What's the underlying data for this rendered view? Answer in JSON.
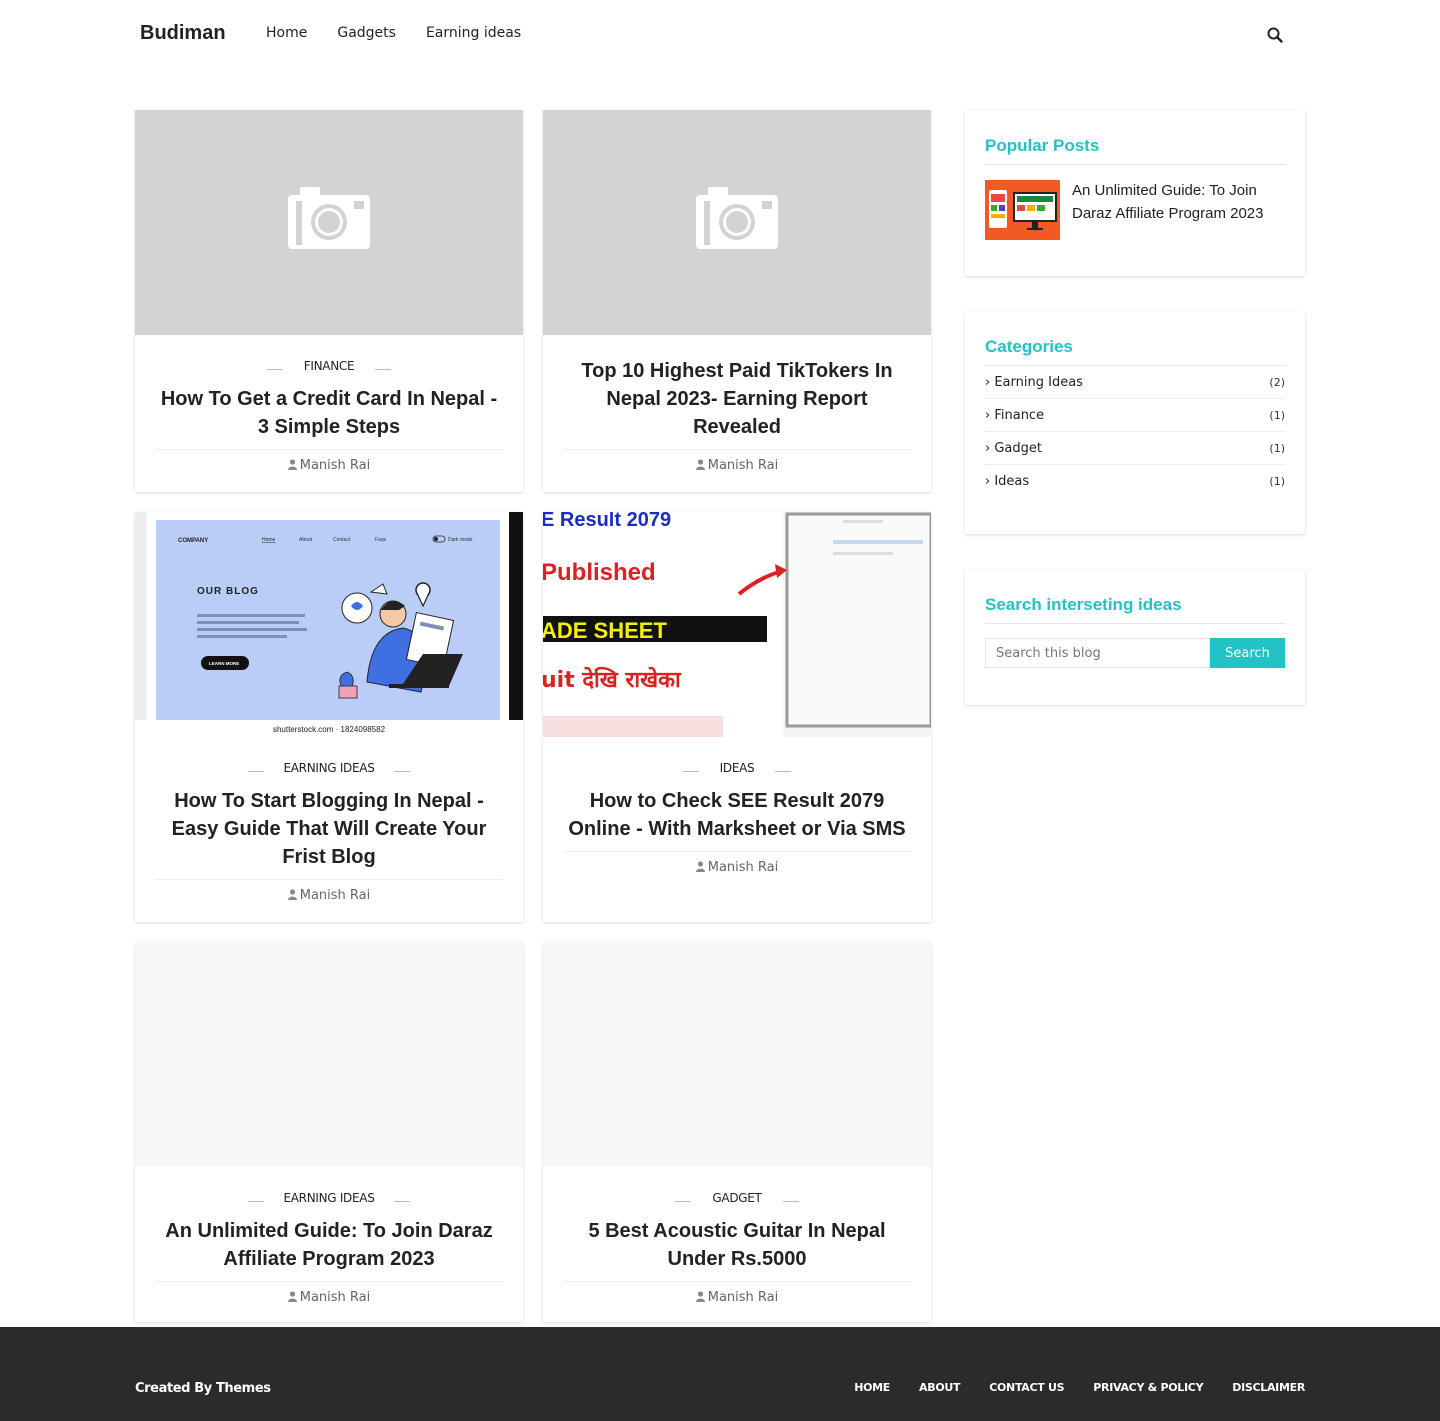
{
  "header": {
    "logo": "Budiman",
    "nav": [
      "Home",
      "Gadgets",
      "Earning ideas"
    ]
  },
  "posts": [
    {
      "category": "Finance",
      "title": "How To Get a Credit Card In Nepal - 3 Simple Steps",
      "author": "Manish Rai",
      "image": "placeholder-camera"
    },
    {
      "category": "",
      "title": "Top 10 Highest Paid TikTokers In Nepal 2023- Earning Report Revealed",
      "author": "Manish Rai",
      "image": "placeholder-camera"
    },
    {
      "category": "Earning Ideas",
      "title": "How To Start Blogging In Nepal - Easy Guide That Will Create Your Frist Blog",
      "author": "Manish Rai",
      "image": "blog-illustration",
      "image_text": {
        "company": "COMPANY",
        "menu": [
          "Home",
          "About",
          "Contact",
          "Faqs"
        ],
        "dark_mode": "Dark mode",
        "heading": "OUR BLOG",
        "button": "LEARN MORE",
        "watermark": "shutterstock.com · 1824098582"
      }
    },
    {
      "category": "Ideas",
      "title": "How to Check SEE Result 2079 Online - With Marksheet or Via SMS",
      "author": "Manish Rai",
      "image": "see-result-screenshot",
      "image_text": {
        "line1": "E Result 2079",
        "line2": "Published",
        "line3": "ADE SHEET",
        "line4": "uit देखि राखेका"
      }
    },
    {
      "category": "Earning Ideas",
      "title": "An Unlimited Guide: To Join Daraz Affiliate Program 2023",
      "author": "Manish Rai",
      "image": "blank"
    },
    {
      "category": "Gadget",
      "title": "5 Best Acoustic Guitar In Nepal Under Rs.5000",
      "author": "Manish Rai",
      "image": "blank"
    }
  ],
  "sidebar": {
    "popular": {
      "heading": "Popular Posts",
      "items": [
        {
          "title": "An Unlimited Guide: To Join Daraz Affiliate Program 2023"
        }
      ]
    },
    "categories": {
      "heading": "Categories",
      "items": [
        {
          "label": "Earning Ideas",
          "count": "(2)"
        },
        {
          "label": "Finance",
          "count": "(1)"
        },
        {
          "label": "Gadget",
          "count": "(1)"
        },
        {
          "label": "Ideas",
          "count": "(1)"
        }
      ]
    },
    "search": {
      "heading": "Search interseting ideas",
      "placeholder": "Search this blog",
      "button": "Search"
    }
  },
  "footer": {
    "created_by": "Created By",
    "theme_link": "Themes",
    "nav": [
      "HOME",
      "ABOUT",
      "CONTACT US",
      "PRIVACY & POLICY",
      "DISCLAIMER"
    ]
  },
  "colors": {
    "accent": "#22c2c6",
    "footer_bg": "#2b2b2b",
    "theme_link": "#e43ab1"
  }
}
